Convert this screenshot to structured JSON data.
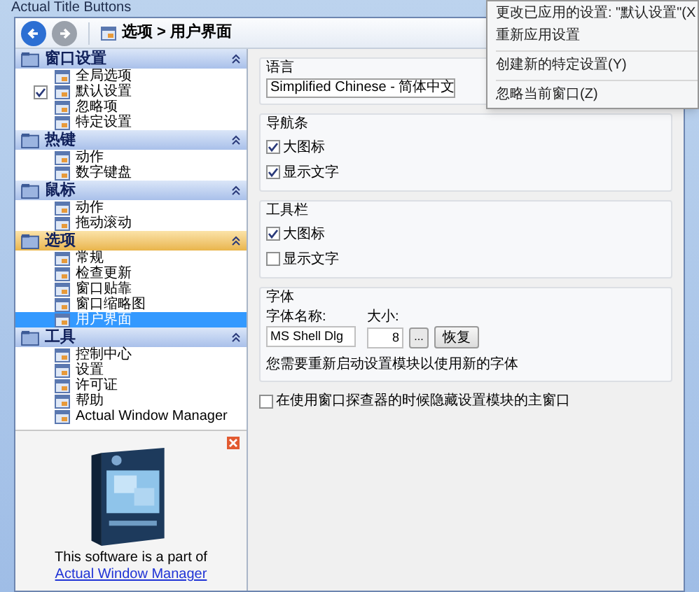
{
  "window": {
    "title": "Actual Title Buttons"
  },
  "toolbar": {
    "breadcrumb": "选项 > 用户界面"
  },
  "sidebar": {
    "sections": [
      {
        "title": "窗口设置",
        "selected": false,
        "items": [
          {
            "label": "全局选项",
            "kind": "plain",
            "selected": false
          },
          {
            "label": "默认设置",
            "kind": "checkbox",
            "checked": true,
            "selected": false
          },
          {
            "label": "忽略项",
            "kind": "plain",
            "selected": false
          },
          {
            "label": "特定设置",
            "kind": "plain",
            "selected": false
          }
        ]
      },
      {
        "title": "热键",
        "selected": false,
        "items": [
          {
            "label": "动作",
            "kind": "plain",
            "selected": false
          },
          {
            "label": "数字键盘",
            "kind": "plain",
            "selected": false
          }
        ]
      },
      {
        "title": "鼠标",
        "selected": false,
        "items": [
          {
            "label": "动作",
            "kind": "plain",
            "selected": false
          },
          {
            "label": "拖动滚动",
            "kind": "plain",
            "selected": false
          }
        ]
      },
      {
        "title": "选项",
        "selected": true,
        "items": [
          {
            "label": "常规",
            "kind": "plain",
            "selected": false
          },
          {
            "label": "检查更新",
            "kind": "plain",
            "selected": false
          },
          {
            "label": "窗口贴靠",
            "kind": "plain",
            "selected": false
          },
          {
            "label": "窗口缩略图",
            "kind": "plain",
            "selected": false
          },
          {
            "label": "用户界面",
            "kind": "plain",
            "selected": true
          }
        ]
      },
      {
        "title": "工具",
        "selected": false,
        "items": [
          {
            "label": "控制中心",
            "kind": "plain",
            "selected": false
          },
          {
            "label": "设置",
            "kind": "plain",
            "selected": false
          },
          {
            "label": "许可证",
            "kind": "plain",
            "selected": false
          },
          {
            "label": "帮助",
            "kind": "plain",
            "selected": false
          },
          {
            "label": "Actual Window Manager",
            "kind": "plain",
            "selected": false
          }
        ]
      }
    ],
    "promo": {
      "text": "This software is a part of",
      "link": "Actual Window Manager"
    }
  },
  "settings": {
    "language": {
      "title": "语言",
      "value": "Simplified Chinese - 简体中文"
    },
    "navbar": {
      "title": "导航条",
      "options": [
        {
          "label": "大图标",
          "checked": true
        },
        {
          "label": "显示文字",
          "checked": true
        }
      ]
    },
    "toolbar": {
      "title": "工具栏",
      "options": [
        {
          "label": "大图标",
          "checked": true
        },
        {
          "label": "显示文字",
          "checked": false
        }
      ]
    },
    "font": {
      "title": "字体",
      "name_label": "字体名称:",
      "size_label": "大小:",
      "name": "MS Shell Dlg",
      "size": "8",
      "browse": "...",
      "reset": "恢复",
      "note": "您需要重新启动设置模块以使用新的字体"
    },
    "hide_main": {
      "label": "在使用窗口探查器的时候隐藏设置模块的主窗口",
      "checked": false
    }
  },
  "context_menu": {
    "items": [
      {
        "kind": "item",
        "label": "更改已应用的设置: \"默认设置\"(X"
      },
      {
        "kind": "item",
        "label": "重新应用设置"
      },
      {
        "kind": "separator"
      },
      {
        "kind": "item",
        "label": "创建新的特定设置(Y)"
      },
      {
        "kind": "separator"
      },
      {
        "kind": "item",
        "label": "忽略当前窗口(Z)"
      }
    ]
  }
}
